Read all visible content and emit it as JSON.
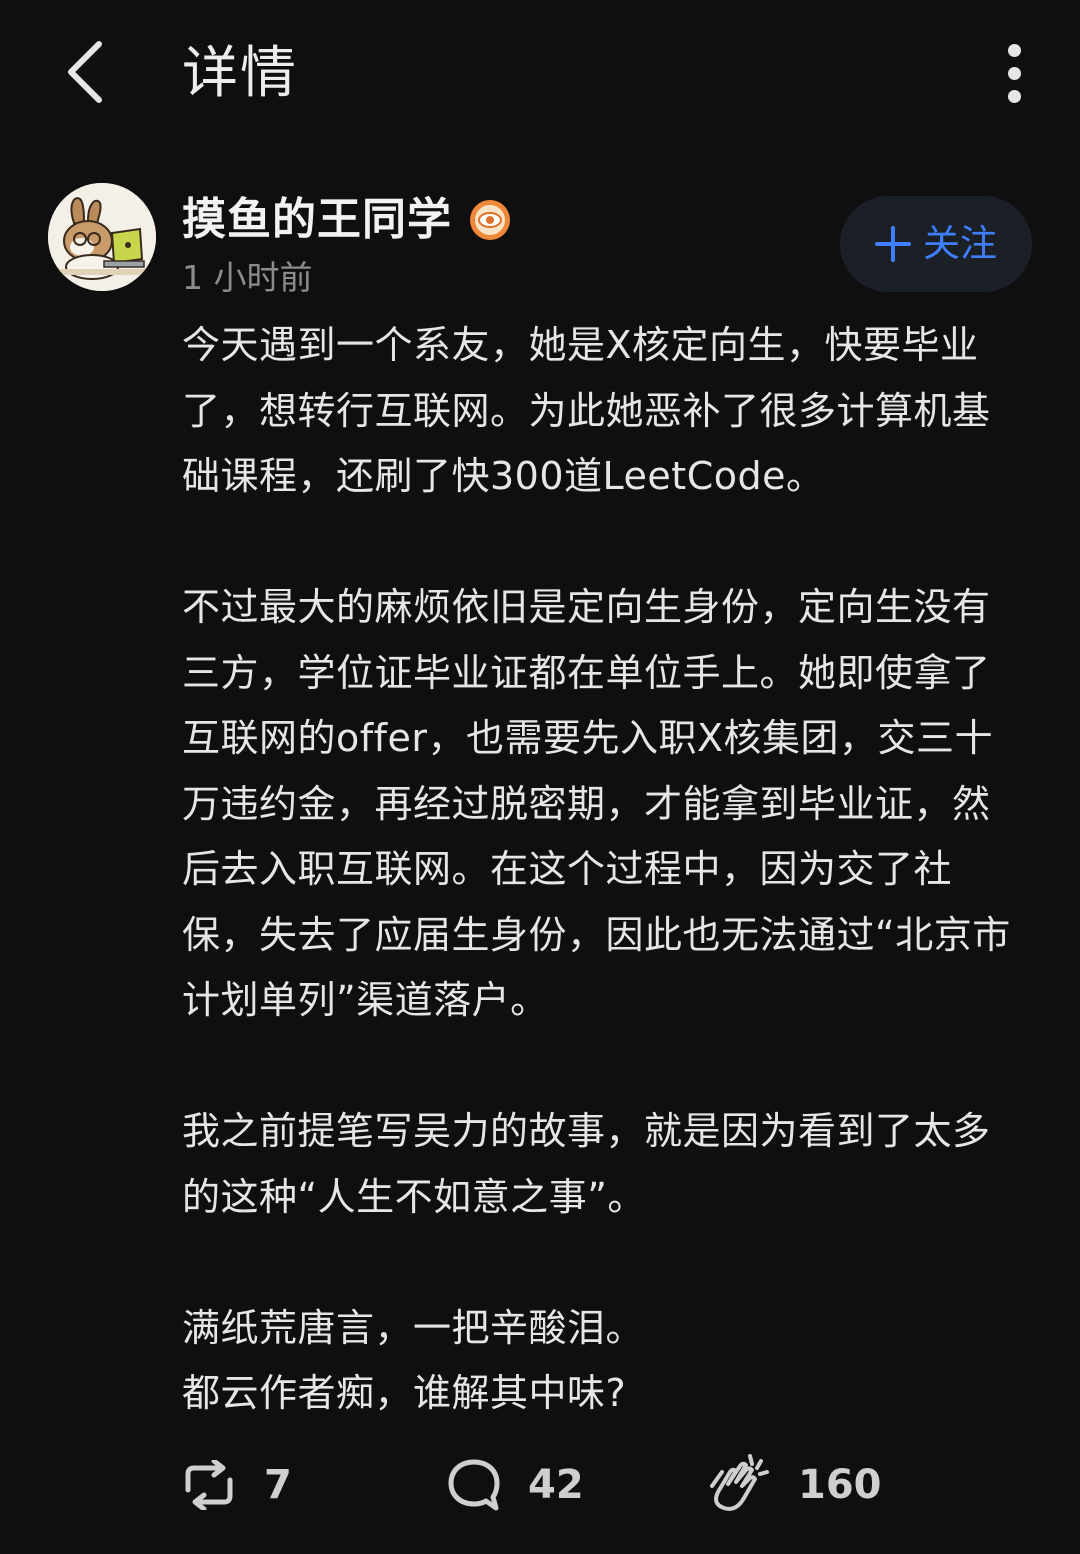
{
  "header": {
    "title": "详情",
    "back_icon": "chevron-left-icon",
    "more_icon": "more-vertical-icon"
  },
  "post": {
    "author": {
      "name": "摸鱼的王同学",
      "avatar": "avatar-rabbit-laptop",
      "badge_icon": "verified-badge-icon"
    },
    "time": "1 小时前",
    "follow_label": "关注",
    "follow_icon": "plus-icon",
    "paragraphs": [
      "今天遇到一个系友，她是X核定向生，快要毕业了，想转行互联网。为此她恶补了很多计算机基础课程，还刷了快300道LeetCode。",
      "不过最大的麻烦依旧是定向生身份，定向生没有三方，学位证毕业证都在单位手上。她即使拿了互联网的offer，也需要先入职X核集团，交三十万违约金，再经过脱密期，才能拿到毕业证，然后去入职互联网。在这个过程中，因为交了社保，失去了应届生身份，因此也无法通过“北京市计划单列”渠道落户。",
      "我之前提笔写吴力的故事，就是因为看到了太多的这种“人生不如意之事”。",
      "满纸荒唐言，一把辛酸泪。\n都云作者痴，谁解其中味?"
    ]
  },
  "actions": {
    "repost": {
      "icon": "repost-icon",
      "count": "7"
    },
    "comment": {
      "icon": "comment-icon",
      "count": "42"
    },
    "clap": {
      "icon": "clap-icon",
      "count": "160"
    }
  },
  "colors": {
    "background": "#0f0f0f",
    "accent": "#3f7fff",
    "badge": "#f0883a",
    "secondary_text": "#8c8c8c"
  }
}
